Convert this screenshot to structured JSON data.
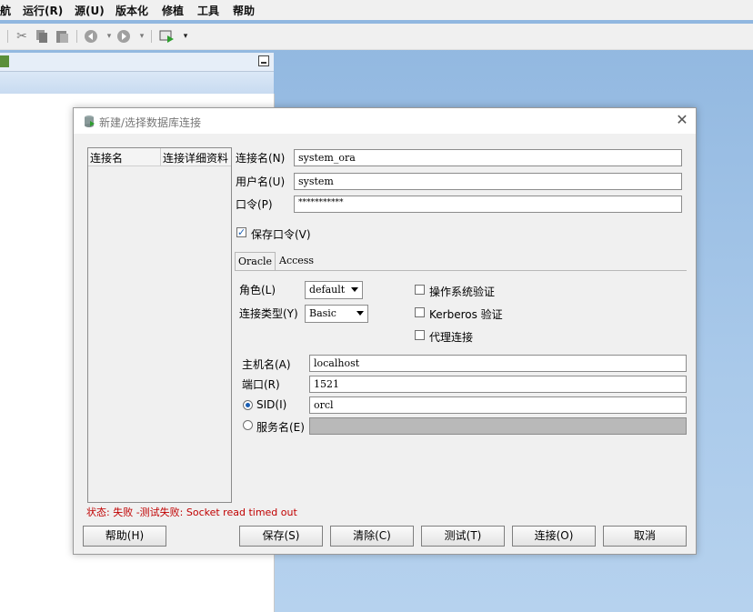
{
  "menu": {
    "items": [
      "航",
      "运行(R)",
      "源(U)",
      "版本化",
      "修植",
      "工具",
      "帮助"
    ]
  },
  "dialog": {
    "title": "新建/选择数据库连接",
    "list": {
      "col_name": "连接名",
      "col_detail": "连接详细资料"
    },
    "conn_name_label": "连接名(N)",
    "conn_name_value": "system_ora",
    "user_label": "用户名(U)",
    "user_value": "system",
    "password_label": "口令(P)",
    "password_value": "***********",
    "save_password_label": "保存口令(V)",
    "save_password_checked": true,
    "tabs": [
      "Oracle",
      "Access"
    ],
    "role_label": "角色(L)",
    "role_value": "default",
    "conn_type_label": "连接类型(Y)",
    "conn_type_value": "Basic",
    "os_auth_label": "操作系统验证",
    "kerberos_label": "Kerberos 验证",
    "proxy_label": "代理连接",
    "host_label": "主机名(A)",
    "host_value": "localhost",
    "port_label": "端口(R)",
    "port_value": "1521",
    "sid_label": "SID(I)",
    "sid_value": "orcl",
    "service_label": "服务名(E)",
    "service_value": "",
    "status_text": "状态: 失败 -测试失败: Socket read timed out",
    "buttons": {
      "help": "帮助(H)",
      "save": "保存(S)",
      "clear": "清除(C)",
      "test": "测试(T)",
      "connect": "连接(O)",
      "cancel": "取消"
    }
  }
}
